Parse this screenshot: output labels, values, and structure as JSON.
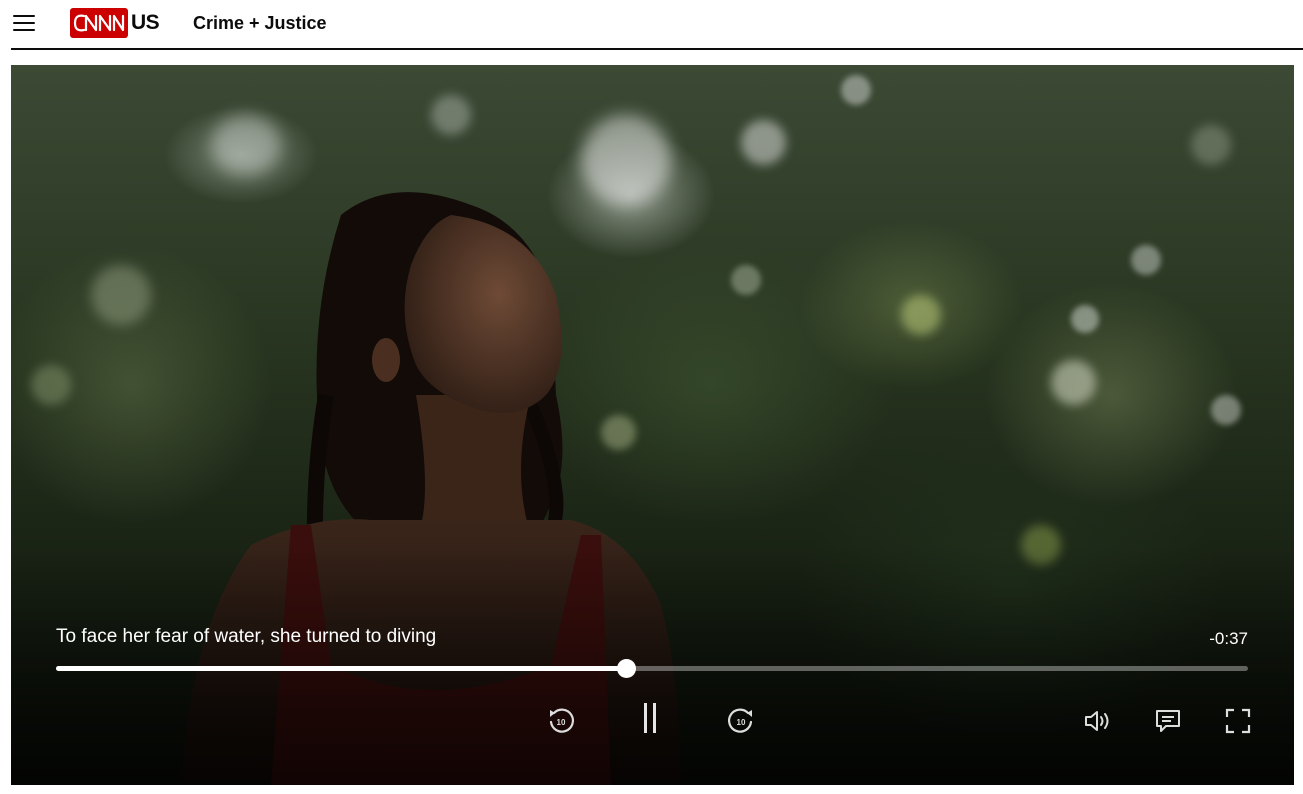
{
  "header": {
    "logo_text": "CNN",
    "edition": "US",
    "section": "Crime + Justice"
  },
  "colors": {
    "brand_red": "#cc0000",
    "text": "#0c0c0c",
    "player_controls": "#ffffff"
  },
  "video": {
    "title": "To face her fear of water, she turned to diving",
    "time_remaining": "-0:37",
    "progress": 0.478,
    "skip_seconds": "10",
    "state": "playing"
  },
  "controls": {
    "center": [
      "rewind-10-icon",
      "pause-icon",
      "forward-10-icon"
    ],
    "right": [
      "volume-icon",
      "captions-icon",
      "fullscreen-icon"
    ]
  }
}
